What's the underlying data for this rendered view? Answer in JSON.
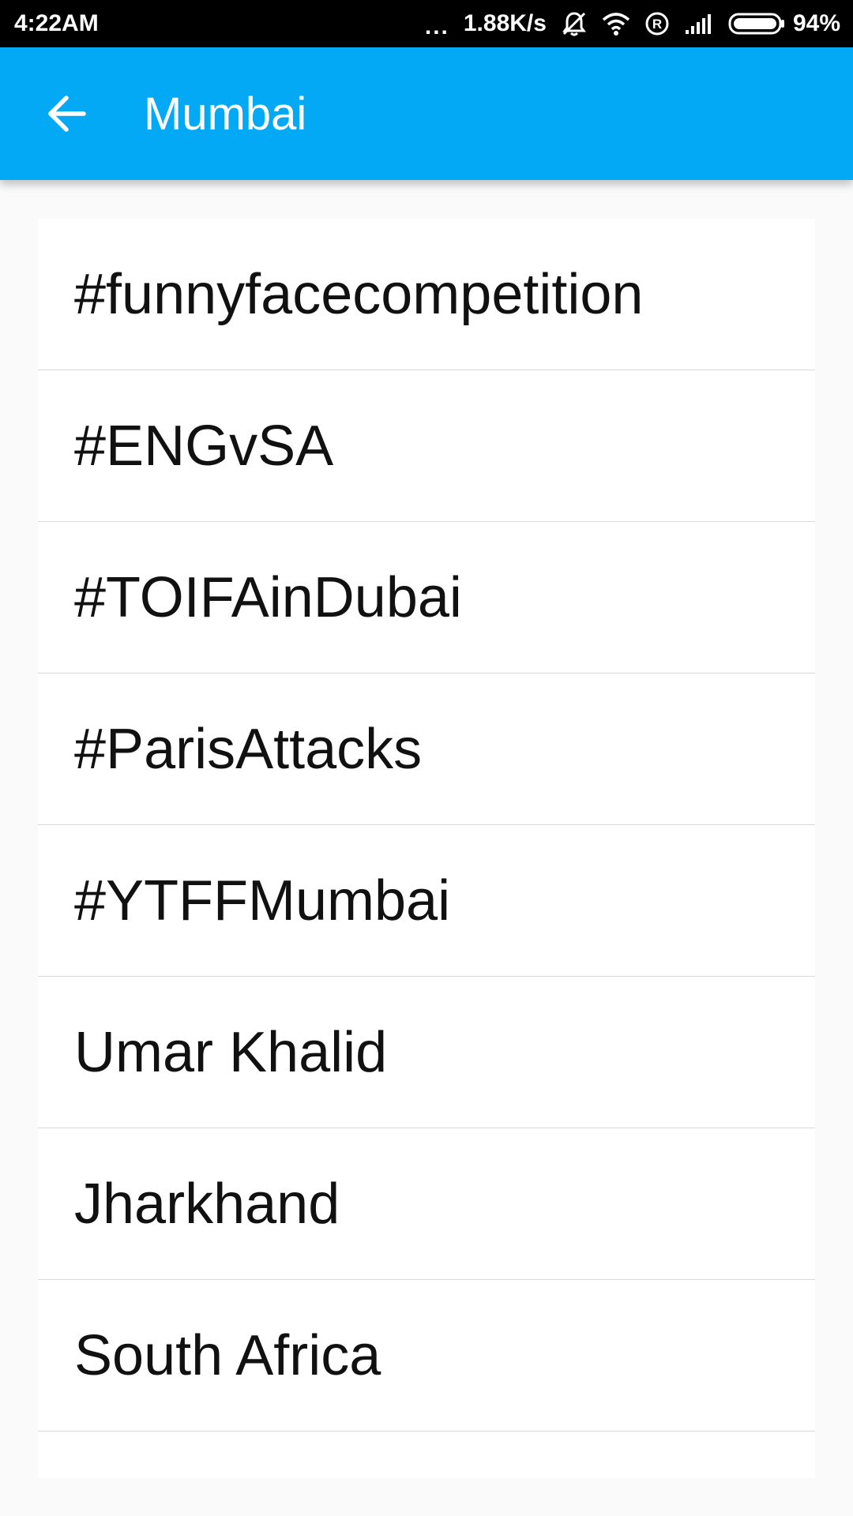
{
  "status_bar": {
    "time": "4:22AM",
    "dots": "...",
    "network_speed": "1.88K/s",
    "battery_percent": "94%",
    "icons": [
      "notifications-off-icon",
      "wifi-icon",
      "registered-icon",
      "signal-icon",
      "battery-icon"
    ]
  },
  "app_bar": {
    "title": "Mumbai",
    "back_icon": "arrow-back-icon",
    "color": "#03a9f4"
  },
  "trends": [
    {
      "label": "#funnyfacecompetition"
    },
    {
      "label": "#ENGvSA"
    },
    {
      "label": "#TOIFAinDubai"
    },
    {
      "label": "#ParisAttacks"
    },
    {
      "label": "#YTFFMumbai"
    },
    {
      "label": "Umar Khalid"
    },
    {
      "label": "Jharkhand"
    },
    {
      "label": "South Africa"
    }
  ]
}
